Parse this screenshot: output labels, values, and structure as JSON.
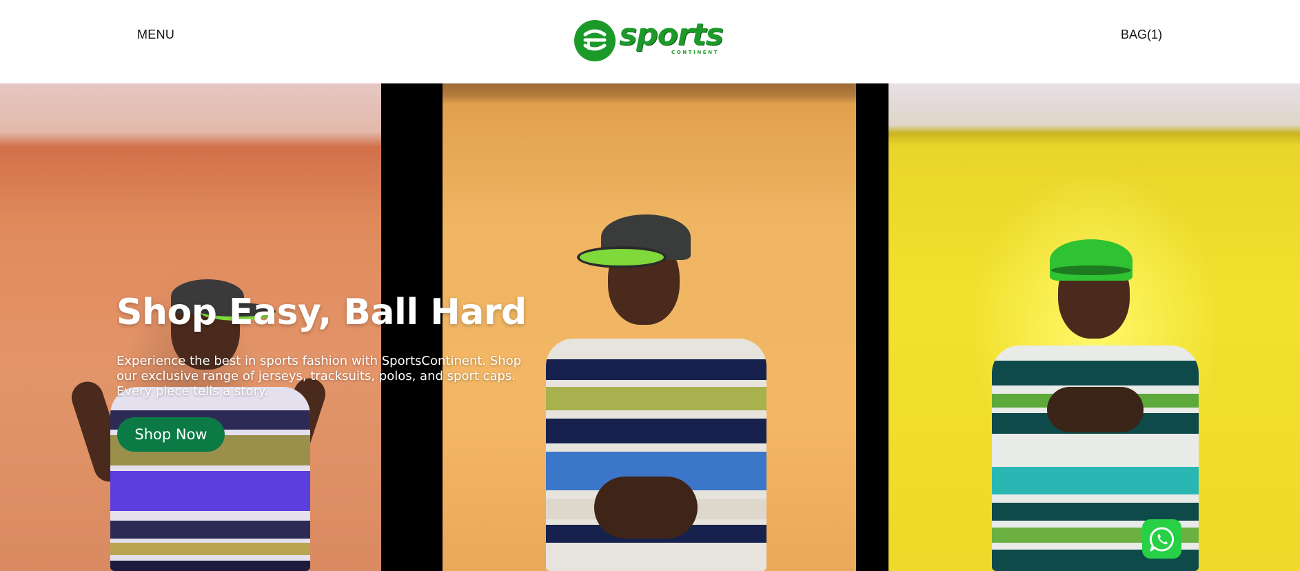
{
  "header": {
    "menu_label": "MENU",
    "bag_label": "BAG(1)",
    "logo": {
      "brand_text": "sports",
      "sub_text": "CONTINENT",
      "brand_color": "#1c9a29"
    }
  },
  "hero": {
    "title": "Shop Easy, Ball Hard",
    "description": "Experience the best in sports fashion with SportsContinent. Shop our exclusive range of jerseys, tracksuits, polos, and sport caps. Every piece tells a story.",
    "cta_label": "Shop Now",
    "cta_color": "#0b7a45",
    "panels": [
      {
        "name": "left-photo",
        "backdrop_color": "#e08a5c"
      },
      {
        "name": "middle-photo",
        "backdrop_color": "#efb562"
      },
      {
        "name": "right-photo",
        "backdrop_color": "#f1e12d"
      }
    ]
  },
  "floating": {
    "whatsapp_icon": "whatsapp-icon",
    "whatsapp_color": "#27d045"
  }
}
